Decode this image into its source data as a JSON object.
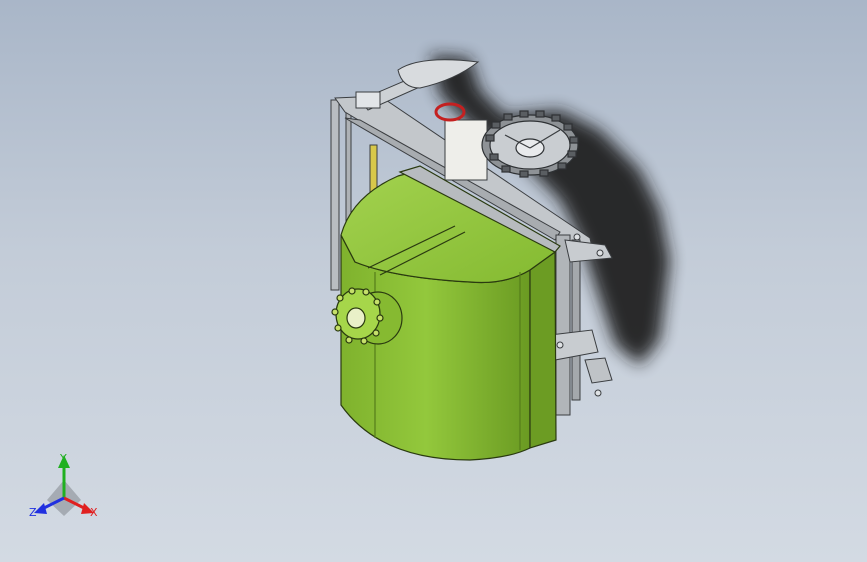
{
  "viewport": {
    "background_top": "#a9b6c8",
    "background_bottom": "#d3dae3"
  },
  "model": {
    "tank_color": "#8fc43a",
    "tank_shade": "#6f9f25",
    "frame_color": "#b5b9bd",
    "shadow_color": "#1e1e1e"
  },
  "triad": {
    "x_label": "X",
    "y_label": "Y",
    "z_label": "Z",
    "x_color": "#e02020",
    "y_color": "#20b020",
    "z_color": "#2030e0"
  }
}
